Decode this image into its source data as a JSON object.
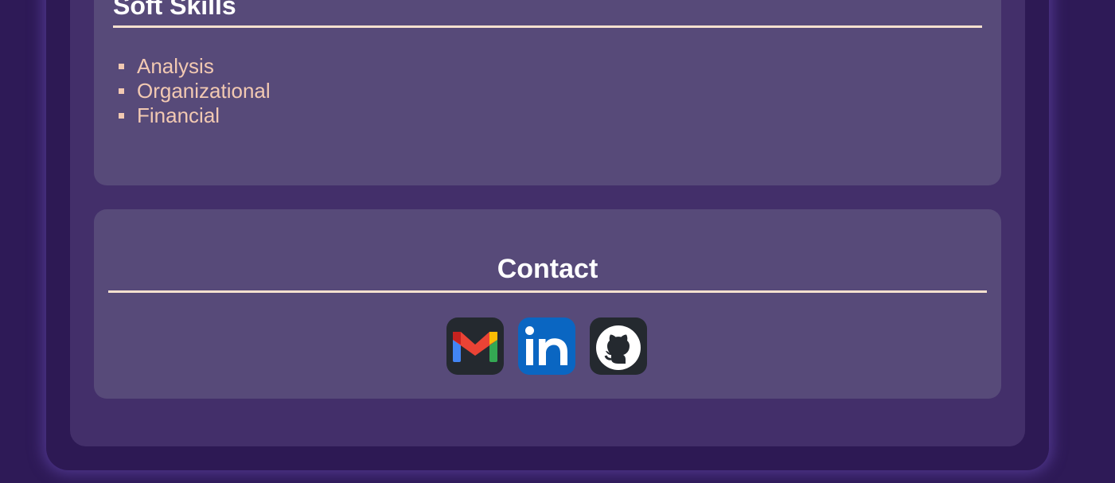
{
  "soft_skills": {
    "title": "Soft Skills",
    "items": [
      "Analysis",
      "Organizational",
      "Financial"
    ]
  },
  "contact": {
    "title": "Contact",
    "links": [
      {
        "icon": "gmail-icon",
        "label": "Gmail"
      },
      {
        "icon": "linkedin-icon",
        "label": "LinkedIn"
      },
      {
        "icon": "github-icon",
        "label": "GitHub"
      }
    ]
  },
  "colors": {
    "page_background": "#2e1a57",
    "panel": "#432f6a",
    "card": "#574a79",
    "heading": "#ffffff",
    "list_text": "#f2c9b2",
    "rule": "#f6e1cf",
    "linkedin_blue": "#0a66c2",
    "icon_dark": "#24292f"
  }
}
